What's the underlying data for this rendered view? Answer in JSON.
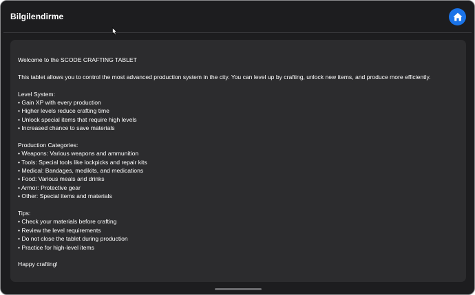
{
  "header": {
    "title": "Bilgilendirme",
    "home_icon": "home-icon",
    "accent": "#1a73e8"
  },
  "content": {
    "welcome": "Welcome to the SCODE CRAFTING TABLET",
    "intro": "This tablet allows you to control the most advanced production system in the city. You can level up by crafting, unlock new items, and produce more efficiently.",
    "level_system": {
      "heading": "Level System:",
      "items": [
        "• Gain XP with every production",
        "• Higher levels reduce crafting time",
        "• Unlock special items that require high levels",
        "• Increased chance to save materials"
      ]
    },
    "categories": {
      "heading": "Production Categories:",
      "items": [
        "• Weapons: Various weapons and ammunition",
        "• Tools: Special tools like lockpicks and repair kits",
        "• Medical: Bandages, medikits, and medications",
        "• Food: Various meals and drinks",
        "• Armor: Protective gear",
        "• Other: Special items and materials"
      ]
    },
    "tips": {
      "heading": "Tips:",
      "items": [
        "• Check your materials before crafting",
        "• Review the level requirements",
        "• Do not close the tablet during production",
        "• Practice for high-level items"
      ]
    },
    "closing": "Happy crafting!"
  }
}
